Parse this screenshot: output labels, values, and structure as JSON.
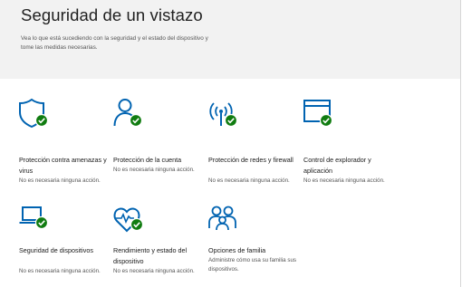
{
  "header": {
    "title": "Seguridad de un vistazo",
    "subtitle": "Vea lo que está sucediendo con la seguridad y el estado del dispositivo y tome las medidas necesarias."
  },
  "colors": {
    "accent": "#0063b1",
    "ok_badge": "#107c10",
    "header_bg": "#f2f2f2"
  },
  "tiles": [
    {
      "icon": "shield-icon",
      "name": "Protección contra amenazas y virus",
      "status": "No es necesaria ninguna acción."
    },
    {
      "icon": "person-icon",
      "name": "Protección de la cuenta",
      "status": "No es necesaria ninguna acción."
    },
    {
      "icon": "wifi-antenna-icon",
      "name": "Protección de redes y firewall",
      "status": "No es necesaria ninguna acción."
    },
    {
      "icon": "browser-window-icon",
      "name": "Control de explorador y aplicación",
      "status": "No es necesaria ninguna acción."
    },
    {
      "icon": "laptop-icon",
      "name": "Seguridad de dispositivos",
      "status": "No es necesaria ninguna acción."
    },
    {
      "icon": "heart-pulse-icon",
      "name": "Rendimiento y estado del dispositivo",
      "status": "No es necesaria ninguna acción."
    },
    {
      "icon": "family-icon",
      "name": "Opciones de familia",
      "status": "Administre cómo usa su familia sus dispositivos."
    }
  ]
}
